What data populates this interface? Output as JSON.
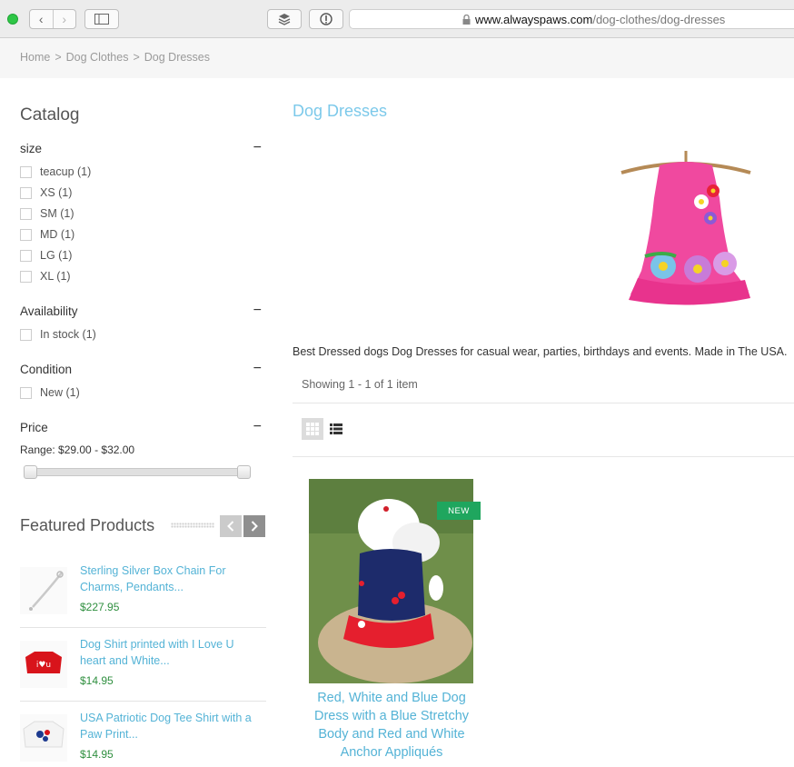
{
  "browser": {
    "url_host": "www.alwayspaws.com",
    "url_path": "/dog-clothes/dog-dresses",
    "nav_back": "‹",
    "nav_forward": "›"
  },
  "breadcrumb": [
    "Home",
    "Dog Clothes",
    "Dog Dresses"
  ],
  "breadcrumb_sep": ">",
  "sidebar": {
    "catalog_title": "Catalog",
    "filters": [
      {
        "title": "size",
        "options": [
          "teacup (1)",
          "XS (1)",
          "SM (1)",
          "MD (1)",
          "LG (1)",
          "XL (1)"
        ]
      },
      {
        "title": "Availability",
        "options": [
          "In stock (1)"
        ]
      },
      {
        "title": "Condition",
        "options": [
          "New (1)"
        ]
      },
      {
        "title": "Price",
        "options": []
      }
    ],
    "collapse_symbol": "−",
    "price_range": "Range: $29.00 - $32.00",
    "featured_title": "Featured Products",
    "featured": [
      {
        "title": "Sterling Silver Box Chain For Charms, Pendants...",
        "price": "$227.95"
      },
      {
        "title": "Dog Shirt printed with I Love U heart and White...",
        "price": "$14.95"
      },
      {
        "title": "USA Patriotic Dog Tee Shirt with a Paw Print...",
        "price": "$14.95"
      }
    ]
  },
  "main": {
    "category_title": "Dog Dresses",
    "description": "Best Dressed dogs Dog Dresses for casual wear, parties, birthdays and events. Made in The USA.",
    "showing": "Showing 1 - 1 of 1 item",
    "product": {
      "badge": "NEW",
      "title": "Red, White and Blue Dog Dress with a Blue Stretchy Body and Red and White Anchor Appliqués"
    }
  },
  "colors": {
    "link_blue": "#54b3d6",
    "title_blue": "#7cc9ea",
    "price_green": "#2f8f3f",
    "badge_green": "#1fa65e"
  },
  "icons": [
    "sidebar-toggle-icon",
    "layers-icon",
    "info-icon",
    "lock-icon",
    "grid-view-icon",
    "list-view-icon",
    "chevron-left-icon",
    "chevron-right-icon"
  ]
}
